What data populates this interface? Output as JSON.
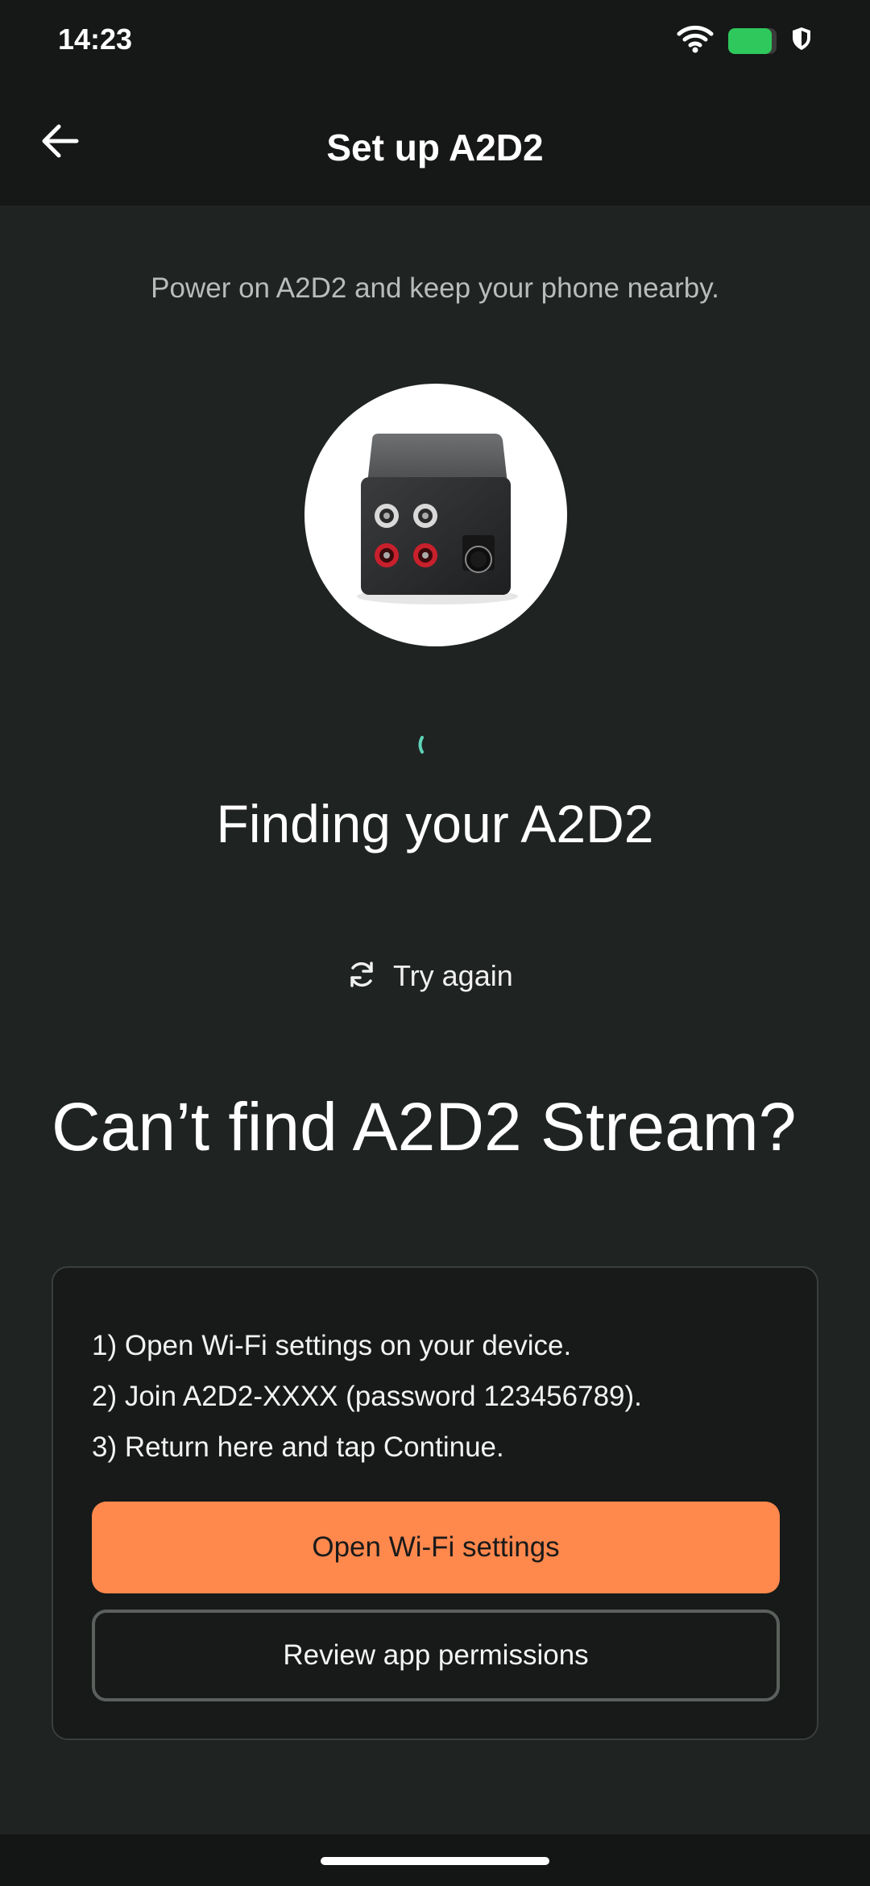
{
  "status_bar": {
    "time": "14:23",
    "battery_level": 0.9,
    "icons": [
      "wifi-icon",
      "battery-icon",
      "vpn-shield-icon"
    ]
  },
  "app_bar": {
    "title": "Set up A2D2",
    "back_icon": "arrow-left-icon"
  },
  "main": {
    "subtitle": "Power on A2D2 and keep your phone nearby.",
    "device_image": "a2d2-device-photo",
    "status_title": "Finding your A2D2",
    "try_again": {
      "icon": "refresh-icon",
      "label": "Try again"
    }
  },
  "help": {
    "heading": "Can’t find A2D2 Stream?",
    "steps": [
      "1) Open Wi-Fi settings on your device.",
      "2) Join A2D2-XXXX (password 123456789).",
      "3) Return here and tap Continue."
    ],
    "primary_button": "Open Wi-Fi settings",
    "secondary_button": "Review app permissions"
  },
  "colors": {
    "background": "#1f2321",
    "bar_background": "#161817",
    "accent": "#ff884d",
    "battery": "#2ec85c",
    "spinner": "#5fd3b8"
  }
}
